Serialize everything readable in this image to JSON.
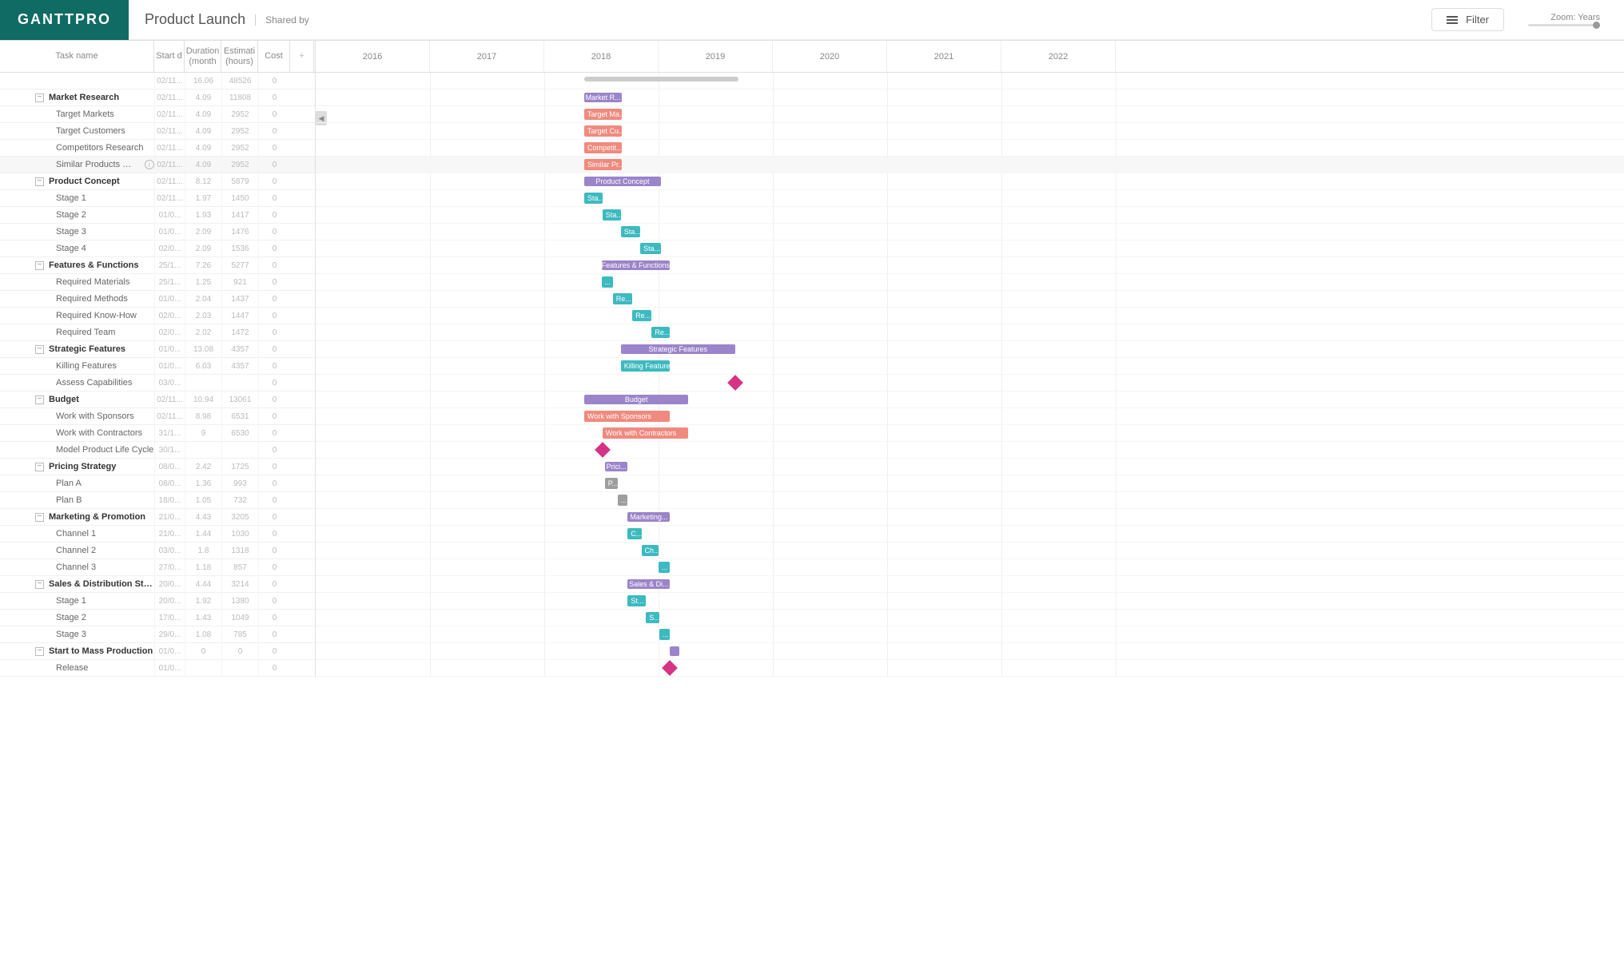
{
  "header": {
    "logo": "GANTTPRO",
    "project": "Product Launch",
    "shared_by": "Shared by",
    "filter": "Filter",
    "zoom": "Zoom: Years"
  },
  "columns": {
    "task": "Task name",
    "start": "Start d",
    "duration": "Duration (month",
    "estimate": "Estimati (hours)",
    "cost": "Cost",
    "plus": "+"
  },
  "years": [
    "2016",
    "2017",
    "2018",
    "2019",
    "2020",
    "2021",
    "2022"
  ],
  "chart_data": {
    "type": "gantt",
    "time_axis": {
      "unit": "year",
      "start": 2016,
      "end": 2022
    },
    "rows": [
      {
        "id": "summary",
        "name": "",
        "type": "summary",
        "start": "02/11...",
        "duration": 16.06,
        "estimate": 48526,
        "cost": 0,
        "bar_start": 2017.85,
        "bar_end": 2019.2
      },
      {
        "id": "mr",
        "name": "Market Research",
        "type": "group",
        "start": "02/11...",
        "duration": 4.09,
        "estimate": 11808,
        "cost": 0,
        "bar_start": 2017.85,
        "bar_end": 2018.18,
        "color": "purple",
        "label": "Market R..."
      },
      {
        "id": "tm",
        "name": "Target Markets",
        "type": "task",
        "start": "02/11...",
        "duration": 4.09,
        "estimate": 2952,
        "cost": 0,
        "bar_start": 2017.85,
        "bar_end": 2018.18,
        "color": "salmon",
        "label": "Target Ma..."
      },
      {
        "id": "tc",
        "name": "Target Customers",
        "type": "task",
        "start": "02/11...",
        "duration": 4.09,
        "estimate": 2952,
        "cost": 0,
        "bar_start": 2017.85,
        "bar_end": 2018.18,
        "color": "salmon",
        "label": "Target Cu..."
      },
      {
        "id": "cr",
        "name": "Competitors Research",
        "type": "task",
        "start": "02/11...",
        "duration": 4.09,
        "estimate": 2952,
        "cost": 0,
        "bar_start": 2017.85,
        "bar_end": 2018.18,
        "color": "salmon",
        "label": "Competit..."
      },
      {
        "id": "spr",
        "name": "Similar Products Research",
        "type": "task",
        "info": true,
        "highlight": true,
        "start": "02/11...",
        "duration": 4.09,
        "estimate": 2952,
        "cost": 0,
        "bar_start": 2017.85,
        "bar_end": 2018.18,
        "color": "salmon",
        "label": "Similar Pr..."
      },
      {
        "id": "pc",
        "name": "Product Concept",
        "type": "group",
        "start": "02/11...",
        "duration": 8.12,
        "estimate": 5879,
        "cost": 0,
        "bar_start": 2017.85,
        "bar_end": 2018.52,
        "color": "purple",
        "label": "Product Concept"
      },
      {
        "id": "s1",
        "name": "Stage 1",
        "type": "task",
        "start": "02/11...",
        "duration": 1.97,
        "estimate": 1450,
        "cost": 0,
        "bar_start": 2017.85,
        "bar_end": 2018.01,
        "color": "teal",
        "label": "Sta..."
      },
      {
        "id": "s2",
        "name": "Stage 2",
        "type": "task",
        "start": "01/0...",
        "duration": 1.93,
        "estimate": 1417,
        "cost": 0,
        "bar_start": 2018.01,
        "bar_end": 2018.17,
        "color": "teal",
        "label": "Sta..."
      },
      {
        "id": "s3",
        "name": "Stage 3",
        "type": "task",
        "start": "01/0...",
        "duration": 2.09,
        "estimate": 1476,
        "cost": 0,
        "bar_start": 2018.17,
        "bar_end": 2018.34,
        "color": "teal",
        "label": "Sta..."
      },
      {
        "id": "s4",
        "name": "Stage 4",
        "type": "task",
        "start": "02/0...",
        "duration": 2.09,
        "estimate": 1536,
        "cost": 0,
        "bar_start": 2018.34,
        "bar_end": 2018.52,
        "color": "teal",
        "label": "Sta..."
      },
      {
        "id": "ff",
        "name": "Features & Functions",
        "type": "group",
        "start": "25/1...",
        "duration": 7.26,
        "estimate": 5277,
        "cost": 0,
        "bar_start": 2018.0,
        "bar_end": 2018.6,
        "color": "purple",
        "label": "Features & Functions"
      },
      {
        "id": "rm",
        "name": "Required Materials",
        "type": "task",
        "start": "25/1...",
        "duration": 1.25,
        "estimate": 921,
        "cost": 0,
        "bar_start": 2018.0,
        "bar_end": 2018.1,
        "color": "teal",
        "label": "..."
      },
      {
        "id": "rme",
        "name": "Required Methods",
        "type": "task",
        "start": "01/0...",
        "duration": 2.04,
        "estimate": 1437,
        "cost": 0,
        "bar_start": 2018.1,
        "bar_end": 2018.27,
        "color": "teal",
        "label": "Re..."
      },
      {
        "id": "rkh",
        "name": "Required Know-How",
        "type": "task",
        "start": "02/0...",
        "duration": 2.03,
        "estimate": 1447,
        "cost": 0,
        "bar_start": 2018.27,
        "bar_end": 2018.44,
        "color": "teal",
        "label": "Re..."
      },
      {
        "id": "rt",
        "name": "Required Team",
        "type": "task",
        "start": "02/0...",
        "duration": 2.02,
        "estimate": 1472,
        "cost": 0,
        "bar_start": 2018.44,
        "bar_end": 2018.6,
        "color": "teal",
        "label": "Re..."
      },
      {
        "id": "sf",
        "name": "Strategic Features",
        "type": "group",
        "start": "01/0...",
        "duration": 13.08,
        "estimate": 4357,
        "cost": 0,
        "bar_start": 2018.17,
        "bar_end": 2019.17,
        "color": "purple",
        "label": "Strategic Features"
      },
      {
        "id": "kf",
        "name": "Killing Features",
        "type": "task",
        "start": "01/0...",
        "duration": 6.03,
        "estimate": 4357,
        "cost": 0,
        "bar_start": 2018.17,
        "bar_end": 2018.6,
        "color": "teal",
        "label": "Killing Features"
      },
      {
        "id": "ac",
        "name": "Assess Capabilities",
        "type": "milestone",
        "start": "03/0...",
        "duration": "",
        "estimate": "",
        "cost": 0,
        "bar_start": 2019.17
      },
      {
        "id": "bd",
        "name": "Budget",
        "type": "group",
        "start": "02/11...",
        "duration": 10.94,
        "estimate": 13061,
        "cost": 0,
        "bar_start": 2017.85,
        "bar_end": 2018.76,
        "color": "purple",
        "label": "Budget"
      },
      {
        "id": "ws",
        "name": "Work with Sponsors",
        "type": "task",
        "start": "02/11...",
        "duration": 8.98,
        "estimate": 6531,
        "cost": 0,
        "bar_start": 2017.85,
        "bar_end": 2018.6,
        "color": "salmon",
        "label": "Work with Sponsors"
      },
      {
        "id": "wc",
        "name": "Work with Contractors",
        "type": "task",
        "start": "31/1...",
        "duration": 9,
        "estimate": 6530,
        "cost": 0,
        "bar_start": 2018.01,
        "bar_end": 2018.76,
        "color": "salmon",
        "label": "Work with Contractors"
      },
      {
        "id": "mpl",
        "name": "Model Product Life Cycle",
        "type": "milestone",
        "start": "30/1...",
        "duration": "",
        "estimate": "",
        "cost": 0,
        "bar_start": 2018.01
      },
      {
        "id": "ps",
        "name": "Pricing Strategy",
        "type": "group",
        "start": "08/0...",
        "duration": 2.42,
        "estimate": 1725,
        "cost": 0,
        "bar_start": 2018.03,
        "bar_end": 2018.23,
        "color": "purple",
        "label": "Prici..."
      },
      {
        "id": "pa",
        "name": "Plan A",
        "type": "task",
        "start": "08/0...",
        "duration": 1.36,
        "estimate": 993,
        "cost": 0,
        "bar_start": 2018.03,
        "bar_end": 2018.14,
        "color": "grey",
        "label": "P..."
      },
      {
        "id": "pb",
        "name": "Plan B",
        "type": "task",
        "start": "18/0...",
        "duration": 1.05,
        "estimate": 732,
        "cost": 0,
        "bar_start": 2018.14,
        "bar_end": 2018.23,
        "color": "grey",
        "label": "..."
      },
      {
        "id": "mp",
        "name": "Marketing & Promotion",
        "type": "group",
        "start": "21/0...",
        "duration": 4.43,
        "estimate": 3205,
        "cost": 0,
        "bar_start": 2018.23,
        "bar_end": 2018.6,
        "color": "purple",
        "label": "Marketing..."
      },
      {
        "id": "c1",
        "name": "Channel 1",
        "type": "task",
        "start": "21/0...",
        "duration": 1.44,
        "estimate": 1030,
        "cost": 0,
        "bar_start": 2018.23,
        "bar_end": 2018.35,
        "color": "teal",
        "label": "C..."
      },
      {
        "id": "c2",
        "name": "Channel 2",
        "type": "task",
        "start": "03/0...",
        "duration": 1.8,
        "estimate": 1318,
        "cost": 0,
        "bar_start": 2018.35,
        "bar_end": 2018.5,
        "color": "teal",
        "label": "Ch..."
      },
      {
        "id": "c3",
        "name": "Channel 3",
        "type": "task",
        "start": "27/0...",
        "duration": 1.18,
        "estimate": 857,
        "cost": 0,
        "bar_start": 2018.5,
        "bar_end": 2018.6,
        "color": "teal",
        "label": "..."
      },
      {
        "id": "sd",
        "name": "Sales & Distribution Strategy",
        "type": "group",
        "start": "20/0...",
        "duration": 4.44,
        "estimate": 3214,
        "cost": 0,
        "bar_start": 2018.23,
        "bar_end": 2018.6,
        "color": "purple",
        "label": "Sales & Di..."
      },
      {
        "id": "sd1",
        "name": "Stage 1",
        "type": "task",
        "start": "20/0...",
        "duration": 1.92,
        "estimate": 1380,
        "cost": 0,
        "bar_start": 2018.23,
        "bar_end": 2018.39,
        "color": "teal",
        "label": "St..."
      },
      {
        "id": "sd2",
        "name": "Stage 2",
        "type": "task",
        "start": "17/0...",
        "duration": 1.43,
        "estimate": 1049,
        "cost": 0,
        "bar_start": 2018.39,
        "bar_end": 2018.51,
        "color": "teal",
        "label": "S..."
      },
      {
        "id": "sd3",
        "name": "Stage 3",
        "type": "task",
        "start": "29/0...",
        "duration": 1.08,
        "estimate": 785,
        "cost": 0,
        "bar_start": 2018.51,
        "bar_end": 2018.6,
        "color": "teal",
        "label": "..."
      },
      {
        "id": "smp",
        "name": "Start to Mass Production",
        "type": "group",
        "start": "01/0...",
        "duration": 0,
        "estimate": 0,
        "cost": 0,
        "bar_start": 2018.6,
        "bar_end": 2018.6,
        "color": "purple"
      },
      {
        "id": "rel",
        "name": "Release",
        "type": "milestone",
        "start": "01/0...",
        "duration": "",
        "estimate": "",
        "cost": 0,
        "bar_start": 2018.6
      }
    ]
  }
}
